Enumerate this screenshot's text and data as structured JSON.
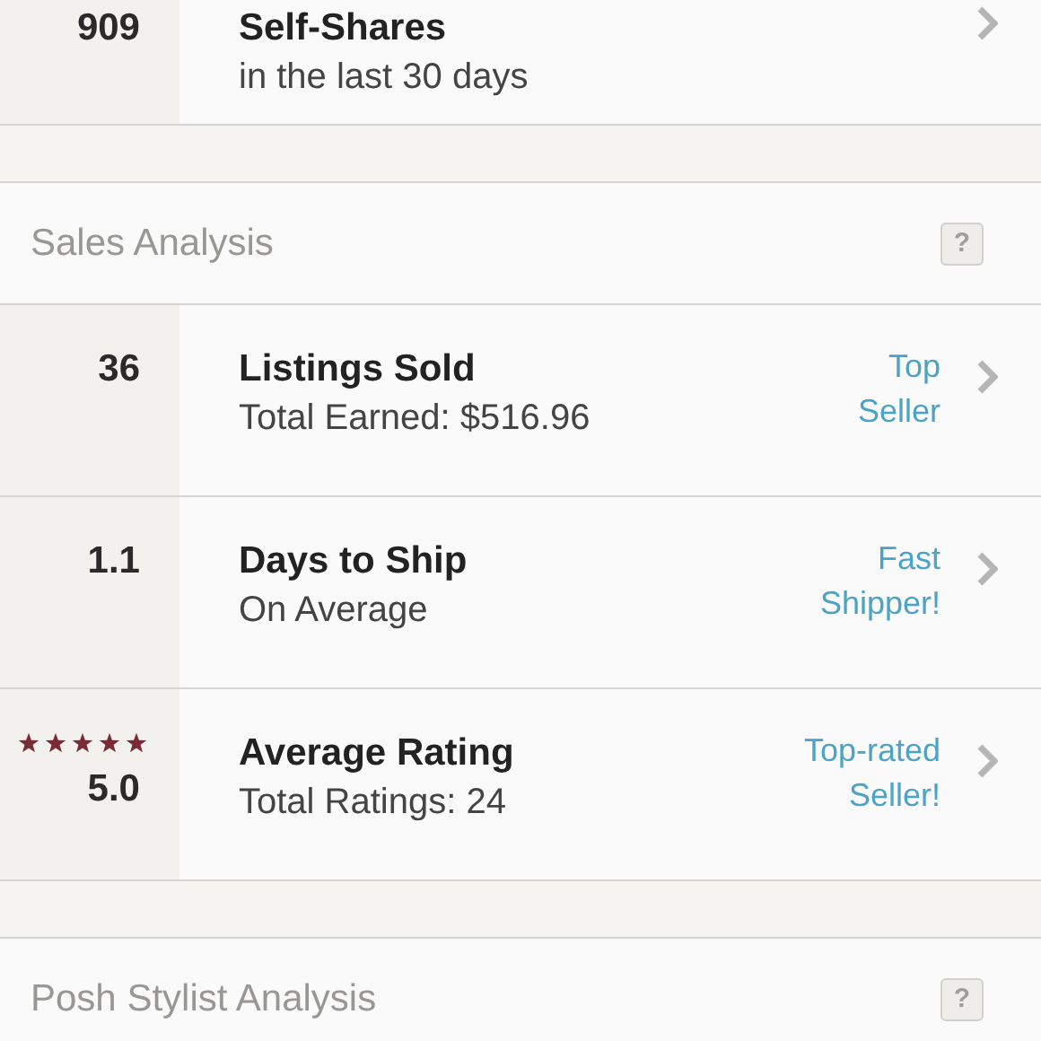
{
  "sections": [
    {
      "rows": [
        {
          "value": "909",
          "title": "Self-Shares",
          "subtitle": "in the last 30 days"
        }
      ]
    },
    {
      "title": "Sales Analysis",
      "help": "?",
      "rows": [
        {
          "value": "36",
          "title": "Listings Sold",
          "subtitle": "Total Earned: $516.96",
          "badge": [
            "Top",
            "Seller"
          ]
        },
        {
          "value": "1.1",
          "title": "Days to Ship",
          "subtitle": "On Average",
          "badge": [
            "Fast",
            "Shipper!"
          ]
        },
        {
          "value": "5.0",
          "stars": 5,
          "title": "Average Rating",
          "subtitle": "Total Ratings: 24",
          "badge": [
            "Top-rated",
            "Seller!"
          ]
        }
      ]
    },
    {
      "title": "Posh Stylist Analysis",
      "help": "?"
    }
  ]
}
